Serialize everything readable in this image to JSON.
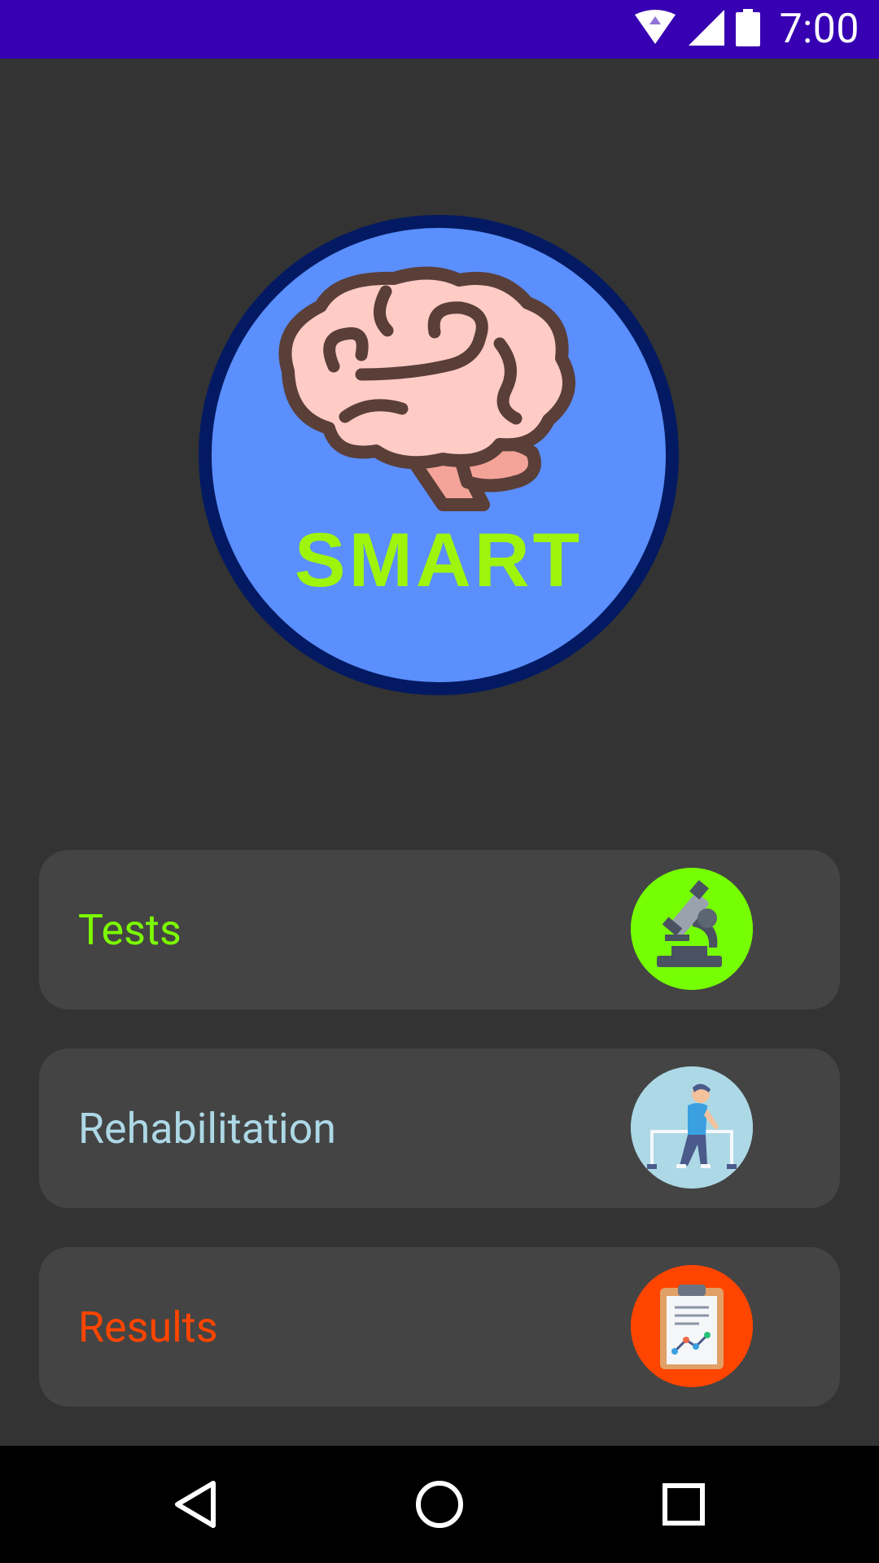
{
  "status_bar": {
    "time": "7:00",
    "icons": [
      "wifi-icon",
      "cell-signal-icon",
      "battery-icon"
    ]
  },
  "logo": {
    "text": "SMART",
    "text_color": "#9ef50b",
    "circle_color": "#5b8ffd",
    "ring_color": "#031a62"
  },
  "menu": [
    {
      "label": "Tests",
      "color": "#7cfc00",
      "icon": "microscope-icon",
      "icon_bg": "#76ff03"
    },
    {
      "label": "Rehabilitation",
      "color": "#add8e6",
      "icon": "rehabilitation-walker-icon",
      "icon_bg": "#add8e6"
    },
    {
      "label": "Results",
      "color": "#ff4500",
      "icon": "clipboard-chart-icon",
      "icon_bg": "#ff4500"
    }
  ],
  "nav_bar": {
    "buttons": [
      "back-icon",
      "home-icon",
      "recents-icon"
    ]
  }
}
